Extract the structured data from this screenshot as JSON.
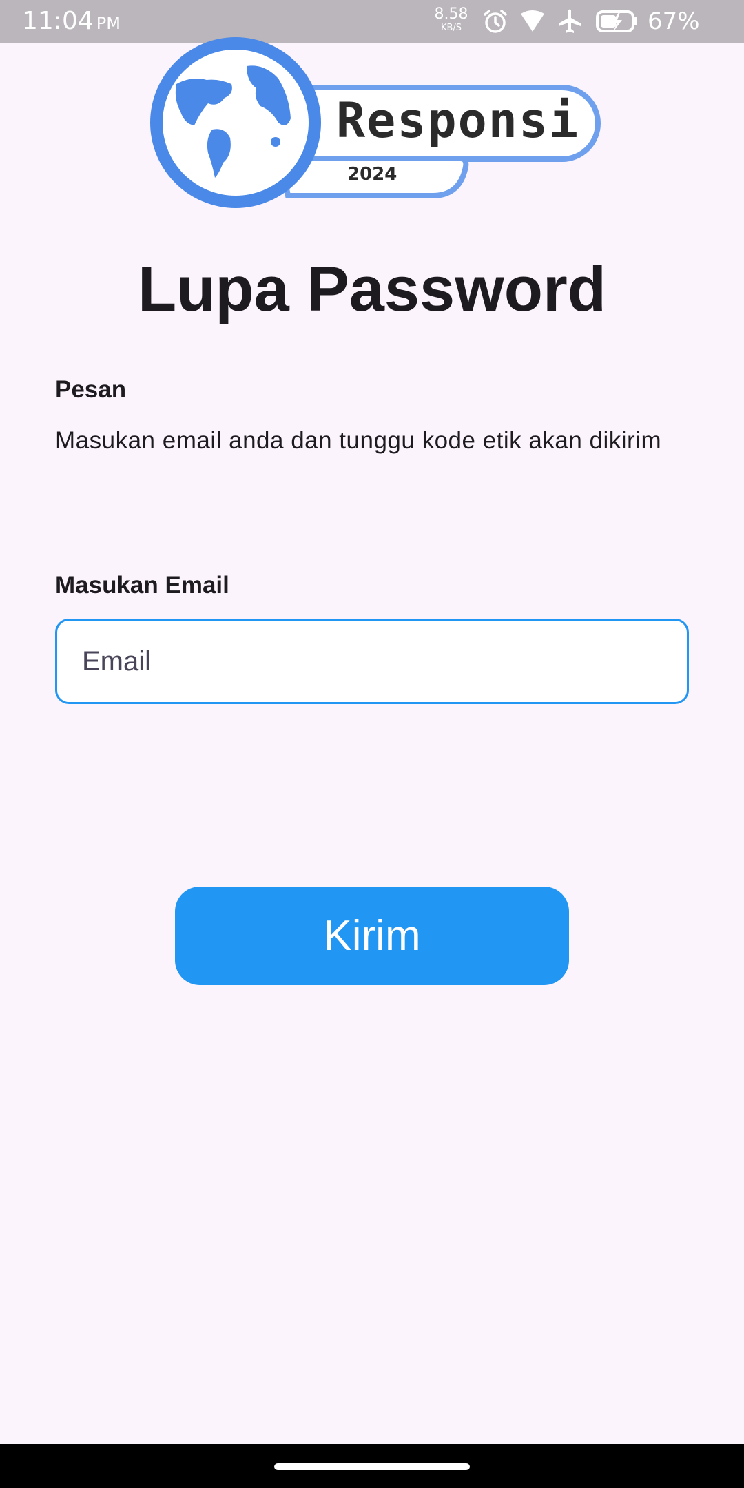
{
  "status_bar": {
    "time": "11:04",
    "ampm": "PM",
    "net_speed": "8.58",
    "net_unit": "KB/S",
    "battery": "67%",
    "icons": [
      "alarm-icon",
      "wifi-icon",
      "airplane-icon",
      "battery-charging-icon"
    ]
  },
  "logo": {
    "word": "Responsi",
    "year": "2024",
    "accent_color": "#4a89e8"
  },
  "page": {
    "title": "Lupa Password"
  },
  "message": {
    "label": "Pesan",
    "text": "Masukan email anda dan tunggu kode etik akan dikirim"
  },
  "email": {
    "label": "Masukan Email",
    "placeholder": "Email",
    "value": ""
  },
  "actions": {
    "send_label": "Kirim"
  },
  "colors": {
    "primary": "#2196f3",
    "background": "#fcf4fc",
    "status_bar": "#bab6bb"
  }
}
